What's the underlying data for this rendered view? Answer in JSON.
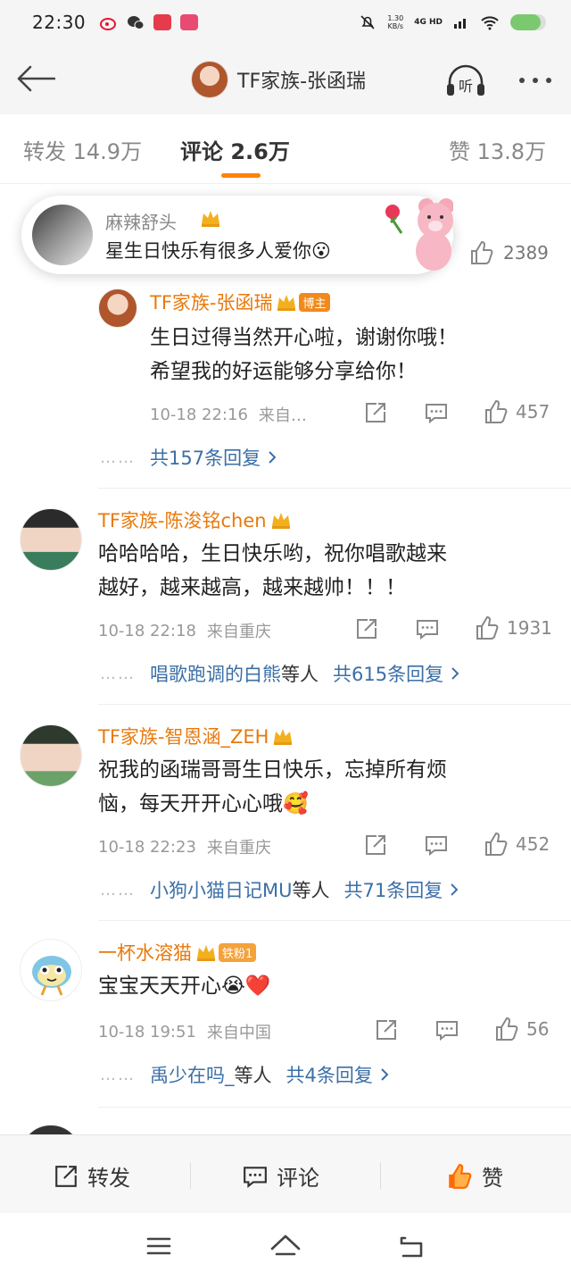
{
  "status_bar": {
    "time": "22:30",
    "net_speed": "1.30",
    "net_unit": "KB/s",
    "signal": "4G HD",
    "battery_level": 0.85
  },
  "nav": {
    "title": "TF家族-张函瑞",
    "listen_label": "听"
  },
  "tabs": [
    {
      "label": "转发",
      "count": "14.9万"
    },
    {
      "label": "评论",
      "count": "2.6万"
    },
    {
      "label": "赞",
      "count": "13.8万"
    }
  ],
  "overlay": {
    "name": "麻辣舒头",
    "text": "星生日快乐有很多人爱你😮",
    "like_count": "2389"
  },
  "comments": [
    {
      "name": "TF家族-张函瑞",
      "badge": "博主",
      "text_line1": "生日过得当然开心啦，谢谢你哦！",
      "text_line2": "希望我的好运能够分享给你！",
      "time": "10-18 22:16",
      "location": "来自…",
      "likes": "457",
      "replies_prefix": "",
      "replies_suffix": "",
      "replies_total": "共157条回复"
    },
    {
      "name": "TF家族-陈浚铭chen",
      "text_line1": "哈哈哈哈，生日快乐哟，祝你唱歌越来",
      "text_line2": "越好，越来越高，越来越帅！！！",
      "time": "10-18 22:18",
      "location": "来自重庆",
      "likes": "1931",
      "replies_prefix": "唱歌跑调的白熊",
      "replies_suffix": "等人",
      "replies_total": "共615条回复"
    },
    {
      "name": "TF家族-智恩涵_ZEH",
      "text_line1": "祝我的函瑞哥哥生日快乐，忘掉所有烦",
      "text_line2": "恼，每天开开心心哦🥰",
      "time": "10-18 22:23",
      "location": "来自重庆",
      "likes": "452",
      "replies_prefix": "小狗小猫日记MU",
      "replies_suffix": "等人",
      "replies_total": "共71条回复"
    },
    {
      "name": "一杯水溶猫",
      "badge": "铁粉1",
      "text_line1": "宝宝天天开心😭❤️",
      "time": "10-18 19:51",
      "location": "来自中国",
      "likes": "56",
      "replies_prefix": "禹少在吗_",
      "replies_suffix": "等人",
      "replies_total": "共4条回复"
    }
  ],
  "bottom_bar": {
    "repost": "转发",
    "comment": "评论",
    "like": "赞"
  },
  "colors": {
    "accent": "#ff8200",
    "name_orange": "#e8790c",
    "link_blue": "#3b6fa6"
  }
}
